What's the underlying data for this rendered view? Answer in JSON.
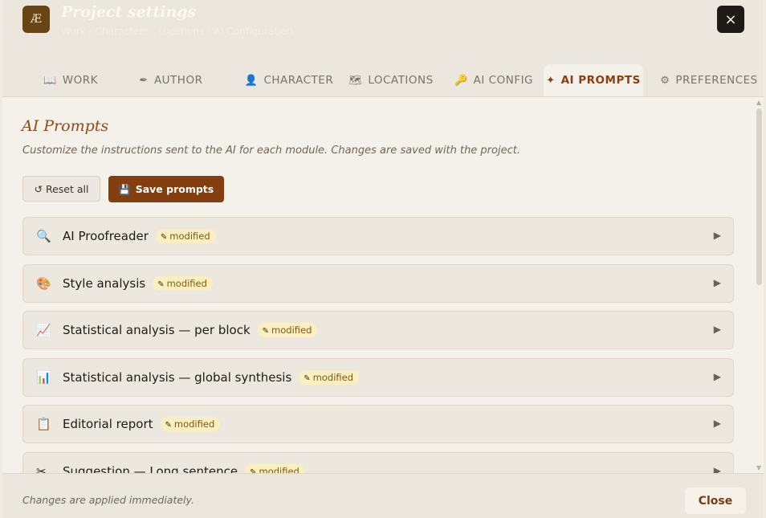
{
  "header": {
    "logo_text": "Æ",
    "title": "Project settings",
    "breadcrumb": "Work · Characters · Locations · AI Configuration",
    "close_icon": "×"
  },
  "tabs": [
    {
      "icon": "📖",
      "label": "WORK"
    },
    {
      "icon": "✒",
      "label": "AUTHOR"
    },
    {
      "icon": "👤",
      "label": "CHARACTER"
    },
    {
      "icon": "🗺",
      "label": "LOCATIONS"
    },
    {
      "icon": "🔑",
      "label": "AI CONFIG"
    },
    {
      "icon": "✦",
      "label": "AI PROMPTS",
      "active": true
    },
    {
      "icon": "⚙",
      "label": "PREFERENCES"
    }
  ],
  "main": {
    "section_title": "AI Prompts",
    "subtitle": "Customize the instructions sent to the AI for each module. Changes are saved with the project.",
    "reset_label": "↺ Reset all",
    "save_icon": "💾",
    "save_label": "Save prompts",
    "modified_label": "modified",
    "prompts": [
      {
        "icon": "🔍",
        "label": "AI Proofreader"
      },
      {
        "icon": "🎨",
        "label": "Style analysis"
      },
      {
        "icon": "📈",
        "label": "Statistical analysis — per block"
      },
      {
        "icon": "📊",
        "label": "Statistical analysis — global synthesis"
      },
      {
        "icon": "📋",
        "label": "Editorial report"
      },
      {
        "icon": "✂",
        "label": "Suggestion — Long sentence"
      }
    ]
  },
  "footer": {
    "note": "Changes are applied immediately.",
    "close_label": "Close"
  },
  "colors": {
    "accent": "#843f10",
    "active_tab_text": "#8a3f10",
    "badge_bg": "#fbefc0",
    "dark_button": "#1e1a16"
  }
}
